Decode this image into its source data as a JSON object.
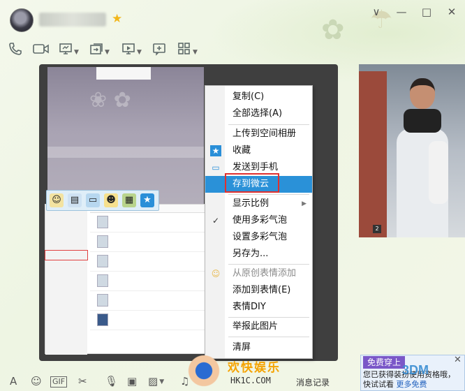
{
  "window": {
    "controls": {
      "menu": "∨",
      "minimize": "—",
      "maximize": "□",
      "close": "✕"
    }
  },
  "toolbar_top": {
    "icons": [
      "phone-icon",
      "video-call-icon",
      "screen-share-icon",
      "file-transfer-icon",
      "remote-assist-icon",
      "add-app-icon",
      "apps-grid-icon"
    ]
  },
  "context_menu": {
    "items": [
      {
        "label": "复制(C)",
        "state": "normal"
      },
      {
        "label": "全部选择(A)",
        "state": "normal"
      },
      {
        "label": "上传到空间相册",
        "state": "normal"
      },
      {
        "label": "收藏",
        "state": "normal"
      },
      {
        "label": "发送到手机",
        "state": "normal"
      },
      {
        "label": "存到微云",
        "state": "active"
      },
      {
        "label": "显示比例",
        "state": "normal"
      },
      {
        "label": "使用多彩气泡",
        "state": "normal"
      },
      {
        "label": "设置多彩气泡",
        "state": "normal"
      },
      {
        "label": "另存为...",
        "state": "normal"
      },
      {
        "label": "从原创表情添加",
        "state": "disabled"
      },
      {
        "label": "添加到表情(E)",
        "state": "normal"
      },
      {
        "label": "表情DIY",
        "state": "normal"
      },
      {
        "label": "举报此图片",
        "state": "normal"
      },
      {
        "label": "清屏",
        "state": "normal"
      }
    ]
  },
  "bottom_bar": {
    "history_label": "消息记录"
  },
  "watermark": {
    "title": "欢快娱乐",
    "site": "HK1C.COM",
    "right_mark": "3DM"
  },
  "promo": {
    "badge": "免费穿上",
    "text": "您已获得装扮使用资格哦，快试试看",
    "link": "更多免费",
    "close": "✕"
  },
  "colors": {
    "menu_highlight": "#2a91d8",
    "red_annotation": "#e0302e",
    "promo_badge": "#7a57c8"
  }
}
